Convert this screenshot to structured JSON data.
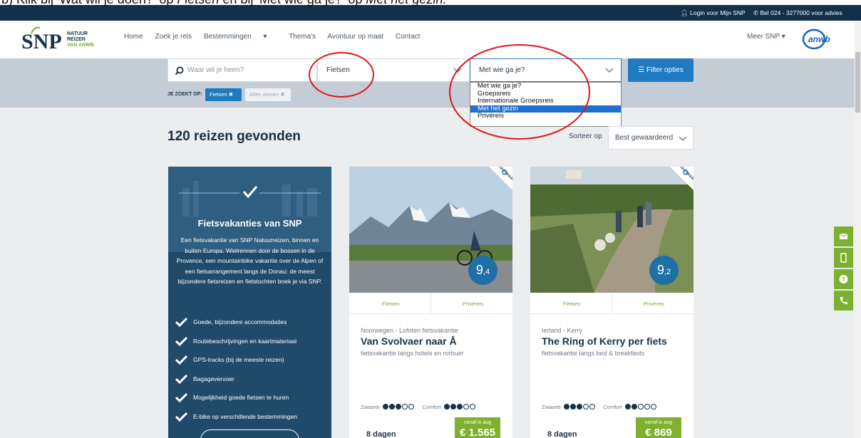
{
  "instruction": {
    "prefix": "b) Klik bij ",
    "q1": "'Wat wil je doen?'",
    "mid1": " op ",
    "a1": "Fietsen",
    "mid2": " en bij ",
    "q2": "'Met wie ga je?'",
    "mid3": " op ",
    "a2": "Met het gezin."
  },
  "topbar": {
    "login": "Login voor Mijn SNP",
    "phone": "Bel 024 - 3277000 voor advies"
  },
  "logo": {
    "letters": "SNP",
    "line1": "NATUUR",
    "line2": "REIZEN",
    "line3": "VAN ANWB"
  },
  "nav": {
    "items": [
      "Home",
      "Zoek je reis",
      "Bestemmingen",
      "Thema's",
      "Avontuur op maat",
      "Contact"
    ],
    "meer": "Meer SNP",
    "partner": "anwb"
  },
  "search": {
    "where_placeholder": "Waar wil je heen?",
    "activity_value": "Fietsen",
    "company_value": "Met wie ga je?",
    "filter_label": "Filter opties",
    "active_label": "JE ZOEKT OP:",
    "active_chip": "Fietsen",
    "clear_chip": "Alles wissen"
  },
  "dropdown": {
    "options": [
      "Met wie ga je?",
      "Groepsreis",
      "Internationale Groepsreis",
      "Met het gezin",
      "Privéreis"
    ],
    "highlighted": "Met het gezin"
  },
  "results": {
    "count_text": "120 reizen gevonden",
    "sort_label": "Sorteer op",
    "sort_value": "Best gewaardeerd"
  },
  "promo": {
    "title": "Fietsvakanties van SNP",
    "description": "Een fietsvakantie van SNP Natuurreizen, binnen en buiten Europa. Wielrennen door de bossen in de Provence, een mountainbike vakantie over de Alpen of een fietsarrangement langs de Donau: de meest bijzondere fietsreizen en fietstochten boek je via SNP.",
    "features": [
      "Goede, bijzondere accommodaties",
      "Routebeschrijvingen en kaartmateriaal",
      "GPS-tracks (bij de meeste reizen)",
      "Bagagevervoer",
      "Mogelijkheid goede fietsen te huren",
      "E-bike op verschillende bestemmingen"
    ]
  },
  "cards": [
    {
      "ribbon": "ROUTEKAART",
      "score_main": "9",
      "score_dec": ",4",
      "tag1": "Fietsen",
      "tag2": "Privéreis",
      "location": "Noorwegen - Lofoten fietsvakantie",
      "title": "Van Svolvaer naar Å",
      "subtitle": "fietsvakantie langs hotels en rorbuer",
      "zwaarte_label": "Zwaarte",
      "zwaarte": 3,
      "comfort_label": "Comfort",
      "comfort": 3,
      "days": "8 dagen",
      "from_label": "vanaf in aug",
      "price": "€ 1.565"
    },
    {
      "ribbon": "ROUTEKAART",
      "score_main": "9",
      "score_dec": ",2",
      "tag1": "Fietsen",
      "tag2": "Privéreis",
      "location": "Ierland - Kerry",
      "title": "The Ring of Kerry per fiets",
      "subtitle": "fietsvakantie langs bed & breakfasts",
      "zwaarte_label": "Zwaarte",
      "zwaarte": 3,
      "comfort_label": "Comfort",
      "comfort": 2,
      "days": "8 dagen",
      "from_label": "vanaf in aug",
      "price": "€ 869"
    }
  ],
  "colors": {
    "navy": "#13304a",
    "blue": "#1f7ac0",
    "green": "#7db032",
    "highlight": "#e0151b"
  }
}
